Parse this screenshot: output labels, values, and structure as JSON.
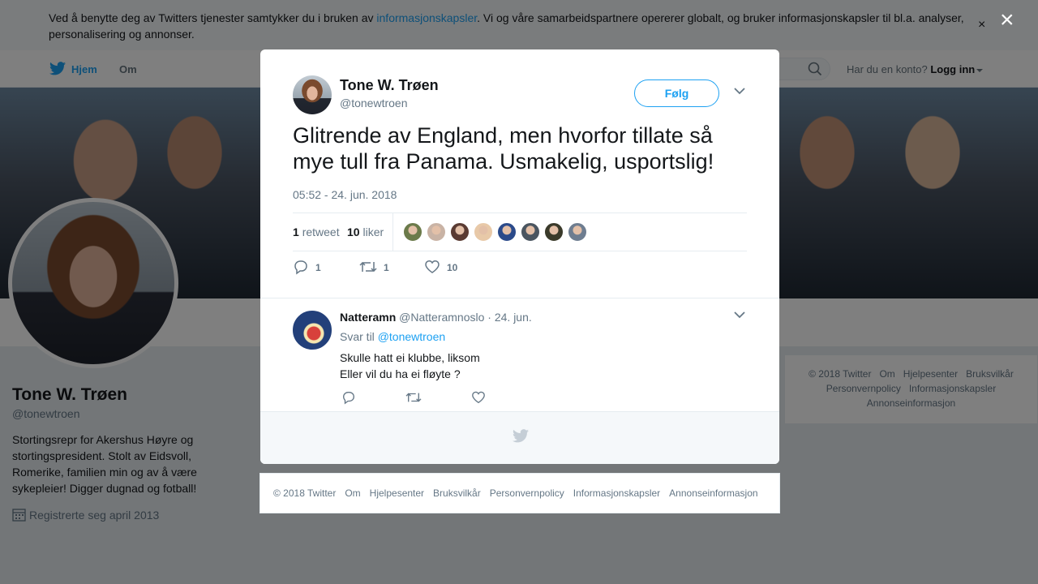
{
  "cookie_banner": {
    "text_before": "Ved å benytte deg av Twitters tjenester samtykker du i bruken av ",
    "link": "informasjonskapsler",
    "text_after": ". Vi og våre samarbeidspartnere opererer globalt, og bruker informasjonskapsler til bl.a. analyser, personalisering og annonser.",
    "close": "×"
  },
  "nav": {
    "home": "Hjem",
    "about": "Om",
    "account_prompt": "Har du en konto?",
    "login": "Logg inn"
  },
  "profile": {
    "name": "Tone W. Trøen",
    "handle": "@tonewtroen",
    "bio": "Stortingsrepr for Akershus Høyre og stortingspresident. Stolt av Eidsvoll, Romerike, familien min og av å være sykepleier! Digger dugnad og fotball!",
    "joined": "Registrerte seg april 2013"
  },
  "side_footer": {
    "items": [
      "© 2018 Twitter",
      "Om",
      "Hjelpesenter",
      "Bruksvilkår",
      "Personvernpolicy",
      "Informasjonskapsler",
      "Annonseinformasjon"
    ]
  },
  "overlay": {
    "close": "×"
  },
  "tweet": {
    "author_name": "Tone W. Trøen",
    "author_handle": "@tonewtroen",
    "follow_label": "Følg",
    "text": "Glitrende av England, men hvorfor tillate så mye tull fra Panama. Usmakelig, usportslig!",
    "timestamp": "05:52 - 24. jun. 2018",
    "retweets_count": "1",
    "retweets_label": "retweet",
    "likes_count": "10",
    "likes_label": "liker",
    "likers_colors": [
      "#6b7a4a",
      "#c9b3a5",
      "#5a3b33",
      "#e8c9a8",
      "#2b4a8a",
      "#4a5560",
      "#3a3a2a",
      "#6e7d90"
    ],
    "actions": {
      "replies": "1",
      "retweets": "1",
      "likes": "10"
    }
  },
  "reply": {
    "author_name": "Natteramn",
    "author_handle": "@Natteramnoslo",
    "date": "· 24. jun.",
    "reply_to_label": "Svar til",
    "reply_to_handle": "@tonewtroen",
    "line1": "Skulle hatt ei klubbe, liksom",
    "line2": "Eller vil du ha ei fløyte  ?"
  },
  "bottom_footer": {
    "items": [
      "© 2018 Twitter",
      "Om",
      "Hjelpesenter",
      "Bruksvilkår",
      "Personvernpolicy",
      "Informasjonskapsler",
      "Annonseinformasjon"
    ]
  },
  "colors": {
    "accent": "#1da1f2",
    "muted": "#657786",
    "text": "#14171a"
  }
}
